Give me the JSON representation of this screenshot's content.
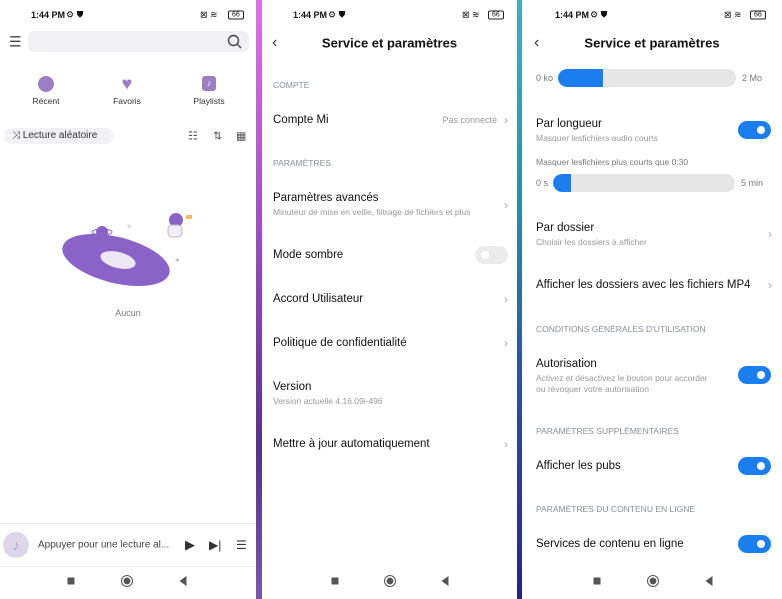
{
  "status": {
    "time": "1:44 PM",
    "battery": "66"
  },
  "library": {
    "search_placeholder": "",
    "shortcuts": [
      {
        "label": "Récent",
        "icon": "clock-icon"
      },
      {
        "label": "Favoris",
        "icon": "heart-icon"
      },
      {
        "label": "Playlists",
        "icon": "music-note-icon"
      }
    ],
    "shuffle_label": "Lecture aléatoire",
    "empty_label": "Aucun",
    "player_text": "Appuyer pour une lecture al...",
    "accent": "#9b7fc4"
  },
  "settings": {
    "title": "Service et paramètres",
    "sections": {
      "account": "COMPTE",
      "params": "PARAMÈTRES"
    },
    "mi_account": {
      "label": "Compte Mi",
      "value": "Pas connecté"
    },
    "advanced": {
      "label": "Paramètres avancés",
      "sub": "Minuteur de mise en veille, filtrage de fichiers et plus"
    },
    "dark_mode": {
      "label": "Mode sombre",
      "on": false
    },
    "user_agreement": "Accord Utilisateur",
    "privacy": "Politique de confidentialité",
    "version": {
      "label": "Version",
      "sub": "Version actuelle 4.16.09i-496"
    },
    "auto_update": "Mettre à jour automatiquement"
  },
  "advanced": {
    "title": "Service et paramètres",
    "size_slider": {
      "min": "0 ko",
      "max": "2 Mo",
      "fraction": 0.25
    },
    "by_length": {
      "label": "Par longueur",
      "sub": "Masquer lesfichiers audio courts",
      "on": true
    },
    "length_label": "Masquer lesfichiers plus courts que 0:30",
    "length_slider": {
      "min": "0 s",
      "max": "5 min",
      "fraction": 0.1
    },
    "by_folder": {
      "label": "Par dossier",
      "sub": "Choisir les dossiers à afficher"
    },
    "mp4_folders": "Afficher les dossiers avec les fichiers MP4",
    "terms_section": "CONDITIONS GÉNÉRALES D'UTILISATION",
    "authorization": {
      "label": "Autorisation",
      "sub1": "Activez et désactivez le bouton pour accorder",
      "sub2": "ou révoquer votre autorisation",
      "on": true
    },
    "extra_section": "PARAMÈTRES SUPPLÉMENTAIRES",
    "show_ads": {
      "label": "Afficher les pubs",
      "on": true
    },
    "online_section": "PARAMÈTRES DU CONTENU EN LIGNE",
    "online_services": {
      "label": "Services de contenu en ligne",
      "on": true
    },
    "accent": "#1a7ef0"
  }
}
